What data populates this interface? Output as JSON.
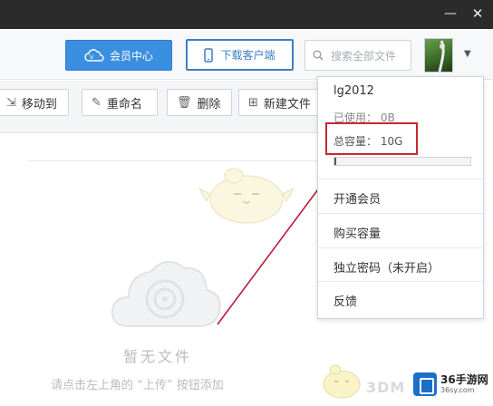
{
  "window": {
    "minimize_glyph": "—",
    "close_glyph": "✕"
  },
  "header": {
    "vip_button": "会员中心",
    "download_button": "下载客户端",
    "search_placeholder": "搜索全部文件"
  },
  "toolbar": {
    "move": "移动到",
    "rename": "重命名",
    "delete": "删除",
    "new_folder": "新建文件"
  },
  "empty_state": {
    "title": "暂无文件",
    "hint": "请点击左上角的 “上传” 按钮添加"
  },
  "account_menu": {
    "username": "lg2012",
    "used": "已使用： 0B",
    "total": "总容量： 10G",
    "usage_fraction": 0.01,
    "items": [
      "开通会员",
      "购买容量",
      "独立密码（未开启）",
      "反馈"
    ]
  },
  "watermark": {
    "text": "3DM"
  },
  "logo": {
    "text": "36手游网",
    "sub": "36sy.com"
  },
  "colors": {
    "accent": "#3b8fe0",
    "highlight": "#c8282e",
    "arrow": "#b81c3a"
  },
  "icons": [
    "cloud-vip-icon",
    "phone-icon",
    "search-icon",
    "caret-down-icon",
    "folder-move-icon",
    "edit-icon",
    "trash-icon",
    "folder-add-icon"
  ]
}
